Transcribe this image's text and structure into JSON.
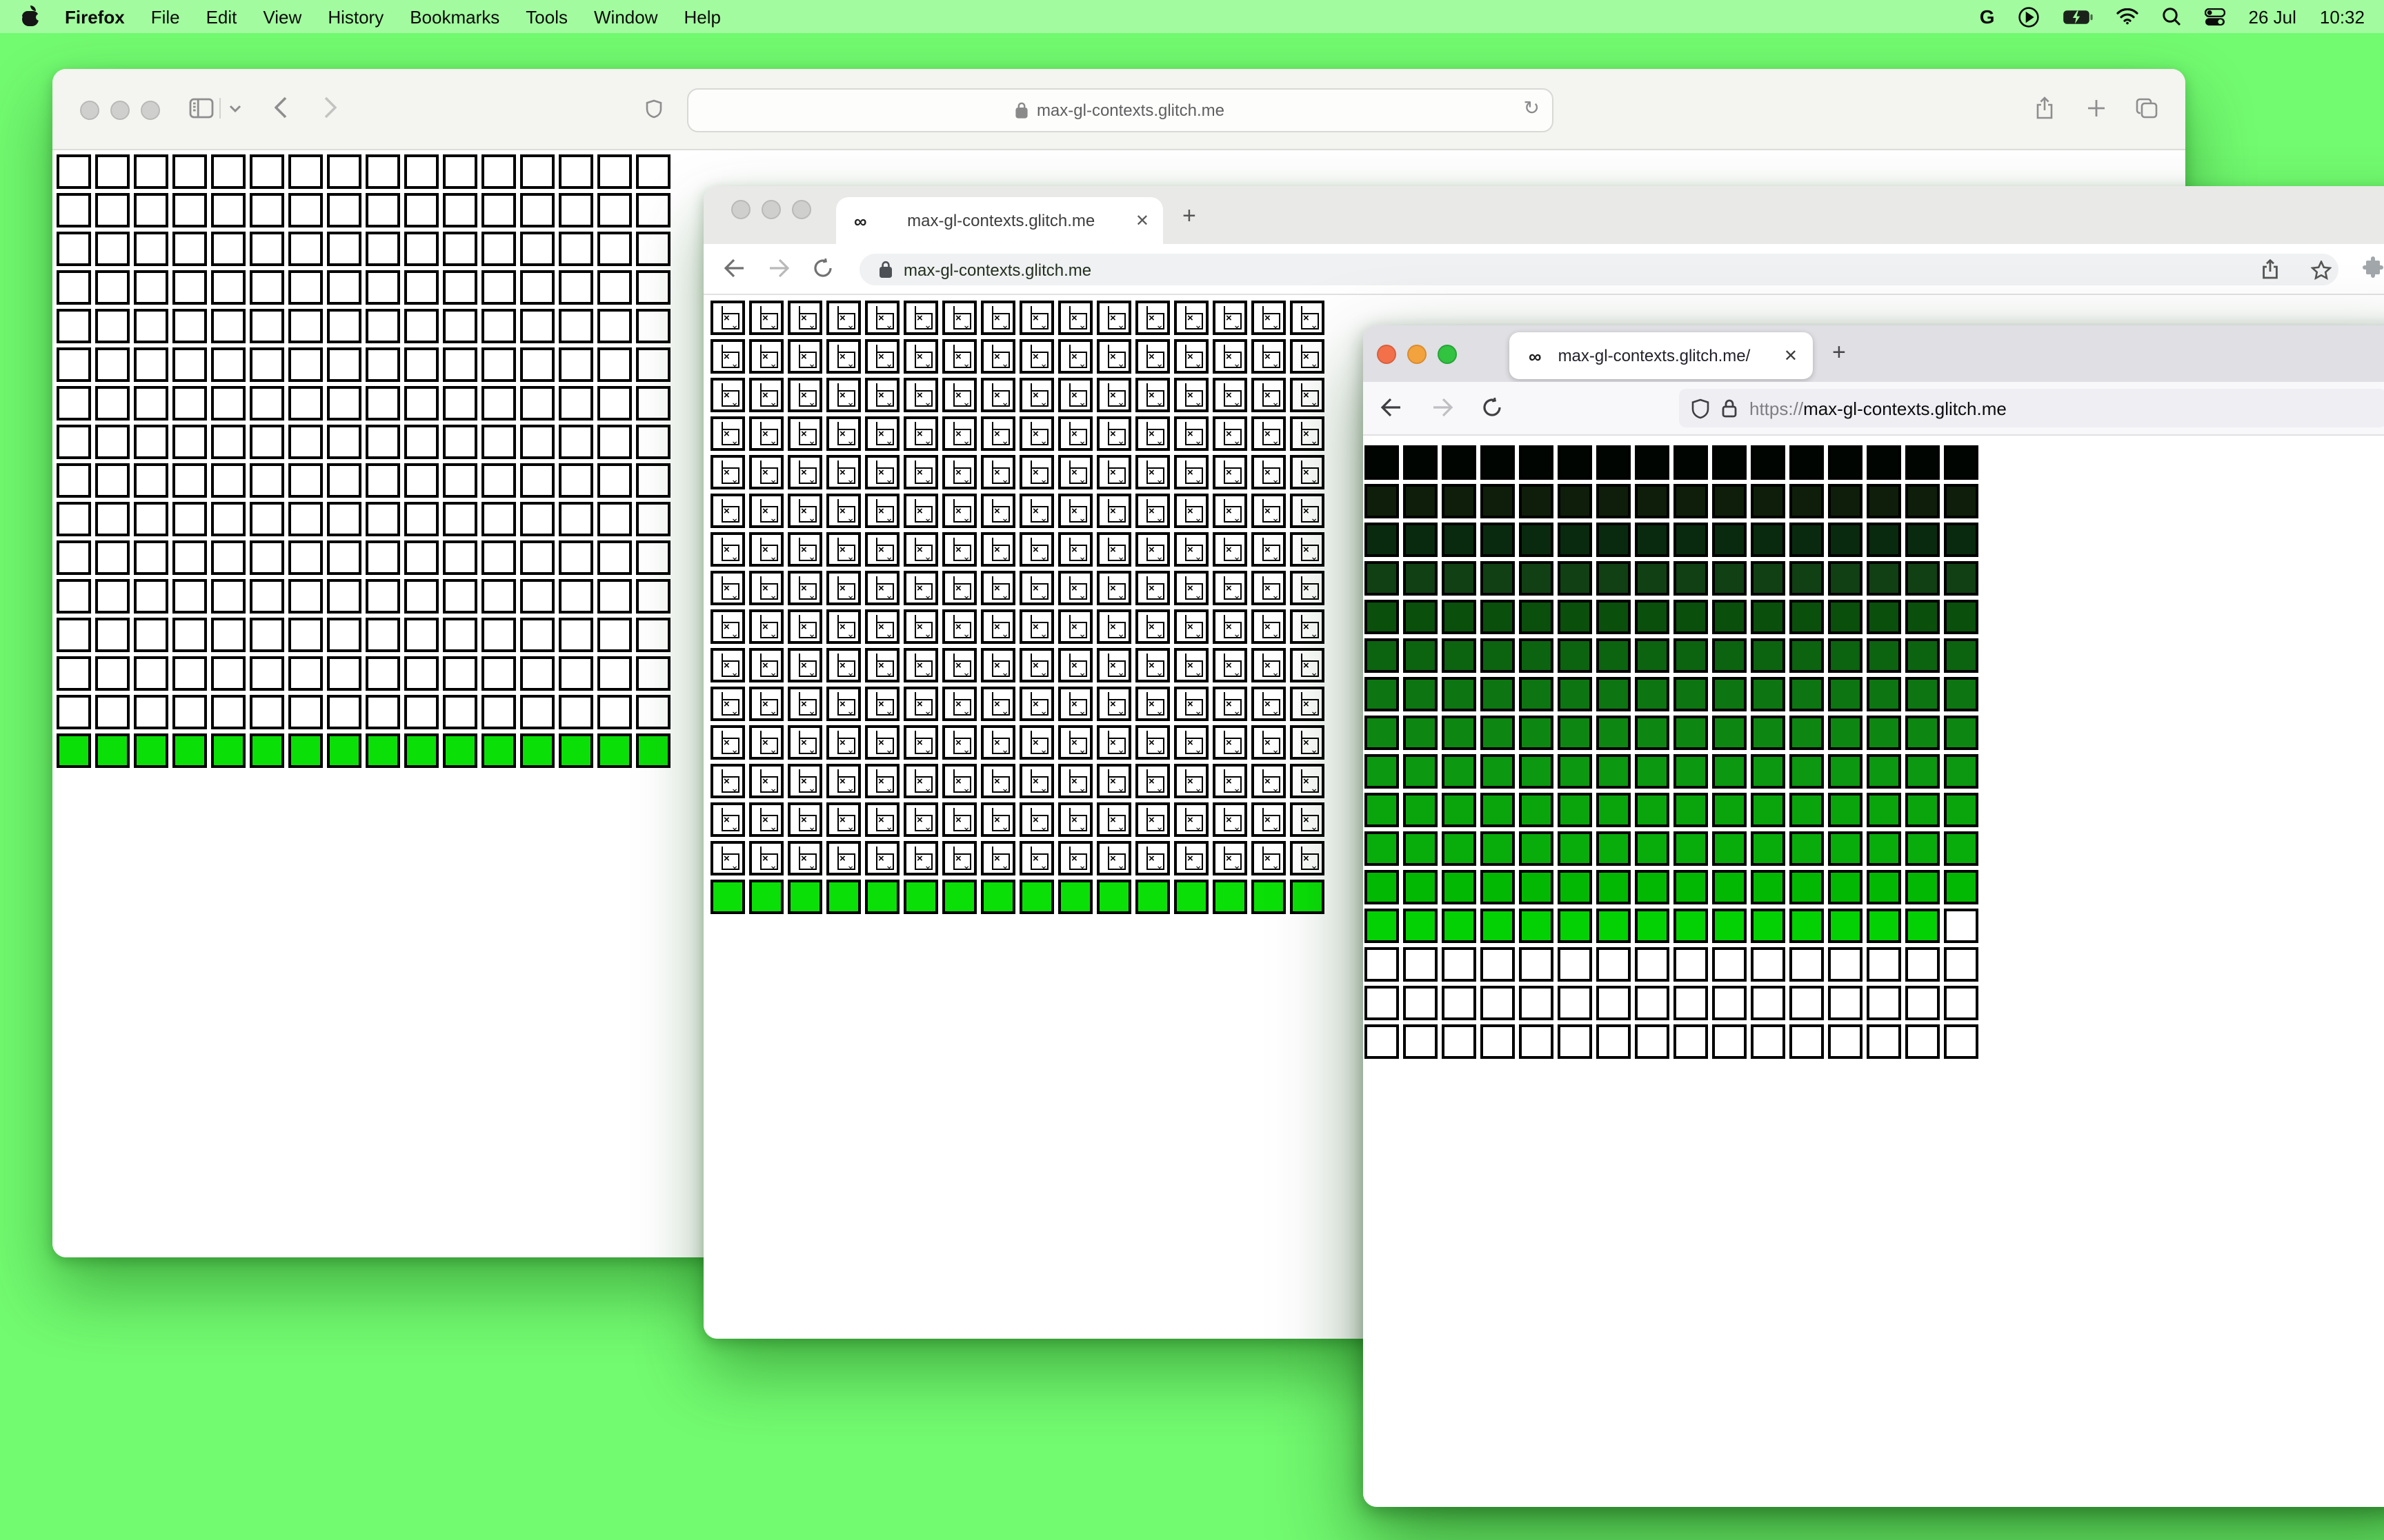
{
  "menu_bar": {
    "app_name": "Firefox",
    "items": [
      "File",
      "Edit",
      "View",
      "History",
      "Bookmarks",
      "Tools",
      "Window",
      "Help"
    ],
    "google_glyph": "G",
    "date": "26 Jul",
    "time": "10:32"
  },
  "safari_window": {
    "url": "max-gl-contexts.glitch.me",
    "reload_glyph": "↻"
  },
  "chrome_window": {
    "tab_title": "max-gl-contexts.glitch.me",
    "favicon": "∞",
    "close_glyph": "✕",
    "new_tab_glyph": "+",
    "url": "max-gl-contexts.glitch.me"
  },
  "firefox_window": {
    "tab_title": "max-gl-contexts.glitch.me/",
    "favicon": "∞",
    "close_glyph": "✕",
    "new_tab_glyph": "+",
    "url_scheme": "https://",
    "url_host": "max-gl-contexts.glitch.me"
  },
  "colors": {
    "desktop": "#72fa70",
    "menubar": "#a2fc9f",
    "canvas_green": "#0bdf08"
  },
  "grids": {
    "broken_glyph": {
      "x": "×",
      "wave": "⌄"
    },
    "canvases": {
      "safari": {
        "cols": 16,
        "cell": 25,
        "gap": 3,
        "rows": [
          {
            "type": "plain",
            "fill": "#ffffff",
            "count": 15
          },
          {
            "type": "plain",
            "fill": "#0bdf08",
            "count": 1
          }
        ]
      },
      "chrome": {
        "cols": 16,
        "cell": 25,
        "gap": 3,
        "rows": [
          {
            "type": "broken",
            "count": 15
          },
          {
            "type": "plain",
            "fill": "#0bdf08",
            "count": 1
          }
        ]
      },
      "firefox": {
        "cols": 16,
        "cell": 25,
        "gap": 3,
        "rows": [
          {
            "type": "plain",
            "fill": "#010501",
            "count": 1
          },
          {
            "type": "plain",
            "fill": "#0e1e0a",
            "count": 1
          },
          {
            "type": "plain",
            "fill": "#092a0e",
            "count": 1
          },
          {
            "type": "plain",
            "fill": "#104013",
            "count": 1
          },
          {
            "type": "plain",
            "fill": "#0a4f0c",
            "count": 1
          },
          {
            "type": "plain",
            "fill": "#0c6310",
            "count": 1
          },
          {
            "type": "plain",
            "fill": "#0d7511",
            "count": 1
          },
          {
            "type": "plain",
            "fill": "#0e8712",
            "count": 1
          },
          {
            "type": "plain",
            "fill": "#0c9810",
            "count": 1
          },
          {
            "type": "plain",
            "fill": "#0aa50d",
            "count": 1
          },
          {
            "type": "plain",
            "fill": "#09ad0b",
            "count": 1
          },
          {
            "type": "plain",
            "fill": "#03b803",
            "count": 1
          },
          {
            "type": "mixed",
            "fill": "#03d103",
            "filled": 15,
            "rest": "#ffffff",
            "count": 1
          },
          {
            "type": "plain",
            "fill": "#ffffff",
            "count": 3
          }
        ]
      }
    }
  }
}
